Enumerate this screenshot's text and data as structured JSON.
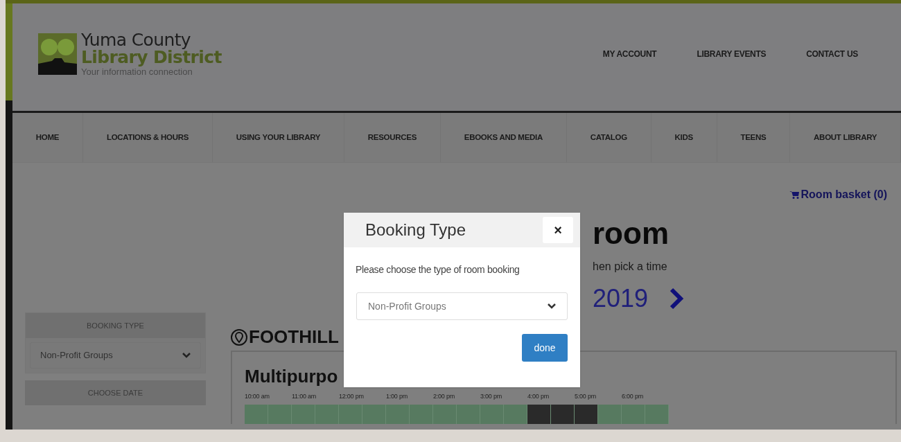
{
  "header": {
    "logo": {
      "line1": "Yuma County",
      "line2": "Library District",
      "tagline": "Your information connection"
    },
    "links": [
      "MY ACCOUNT",
      "LIBRARY EVENTS",
      "CONTACT US"
    ]
  },
  "nav": [
    "HOME",
    "LOCATIONS & HOURS",
    "USING YOUR LIBRARY",
    "RESOURCES",
    "EBOOKS AND MEDIA",
    "CATALOG",
    "KIDS",
    "TEENS",
    "ABOUT LIBRARY"
  ],
  "basket": "Room basket (0)",
  "heading": "room",
  "subheading": "hen pick a time",
  "date": "2019",
  "sidebar": {
    "booking_type_label": "BOOKING TYPE",
    "booking_type_value": "Non-Profit Groups",
    "choose_date_label": "CHOOSE DATE"
  },
  "location": "FOOTHILL",
  "room": {
    "name": "Multipurpo",
    "times": [
      "10:00 am",
      "11:00 am",
      "12:00 pm",
      "1:00 pm",
      "2:00 pm",
      "3:00 pm",
      "4:00 pm",
      "5:00 pm",
      "6:00 pm"
    ],
    "slots": [
      {
        "booked": false
      },
      {
        "booked": false
      },
      {
        "booked": false
      },
      {
        "booked": false
      },
      {
        "booked": false
      },
      {
        "booked": false
      },
      {
        "booked": false
      },
      {
        "booked": false
      },
      {
        "booked": false
      },
      {
        "booked": false
      },
      {
        "booked": false
      },
      {
        "booked": false
      },
      {
        "booked": true
      },
      {
        "booked": true
      },
      {
        "booked": true
      },
      {
        "booked": false
      },
      {
        "booked": false
      },
      {
        "booked": false
      }
    ]
  },
  "dialog": {
    "title": "Booking Type",
    "close": "×",
    "prompt": "Please choose the type of room booking",
    "select_value": "Non-Profit Groups",
    "button": "done"
  }
}
